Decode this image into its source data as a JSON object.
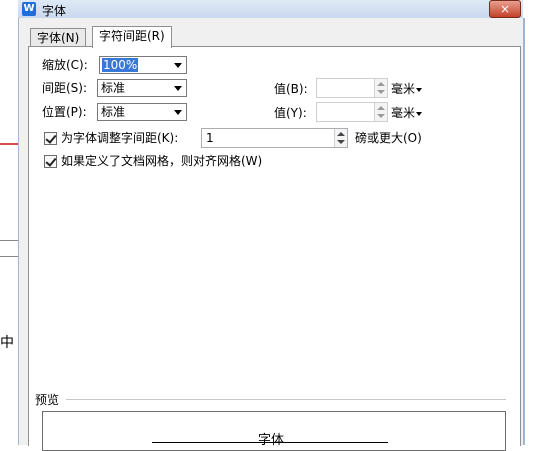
{
  "window": {
    "app_icon": "W",
    "title": "字体",
    "close_glyph": "×"
  },
  "background_doc": {
    "char": "中"
  },
  "tabs": [
    {
      "label": "字体(N)",
      "active": false
    },
    {
      "label": "字符间距(R)",
      "active": true
    }
  ],
  "scale": {
    "label": "缩放(C):",
    "value": "100%"
  },
  "spacing": {
    "label": "间距(S):",
    "value": "标准",
    "amount_label": "值(B):",
    "amount_value": "",
    "unit": "毫米"
  },
  "position": {
    "label": "位置(P):",
    "value": "标准",
    "amount_label": "值(Y):",
    "amount_value": "",
    "unit": "毫米"
  },
  "kerning": {
    "checked": true,
    "label": "为字体调整字间距(K):",
    "value": "1",
    "suffix": "磅或更大(O)"
  },
  "grid": {
    "checked": true,
    "label": "如果定义了文档网格，则对齐网格(W)"
  },
  "preview": {
    "label": "预览",
    "sample_text": "字体"
  },
  "colors": {
    "accent": "#3a78d6",
    "title_bar": "#dfe9f6",
    "close": "#c3412a"
  }
}
